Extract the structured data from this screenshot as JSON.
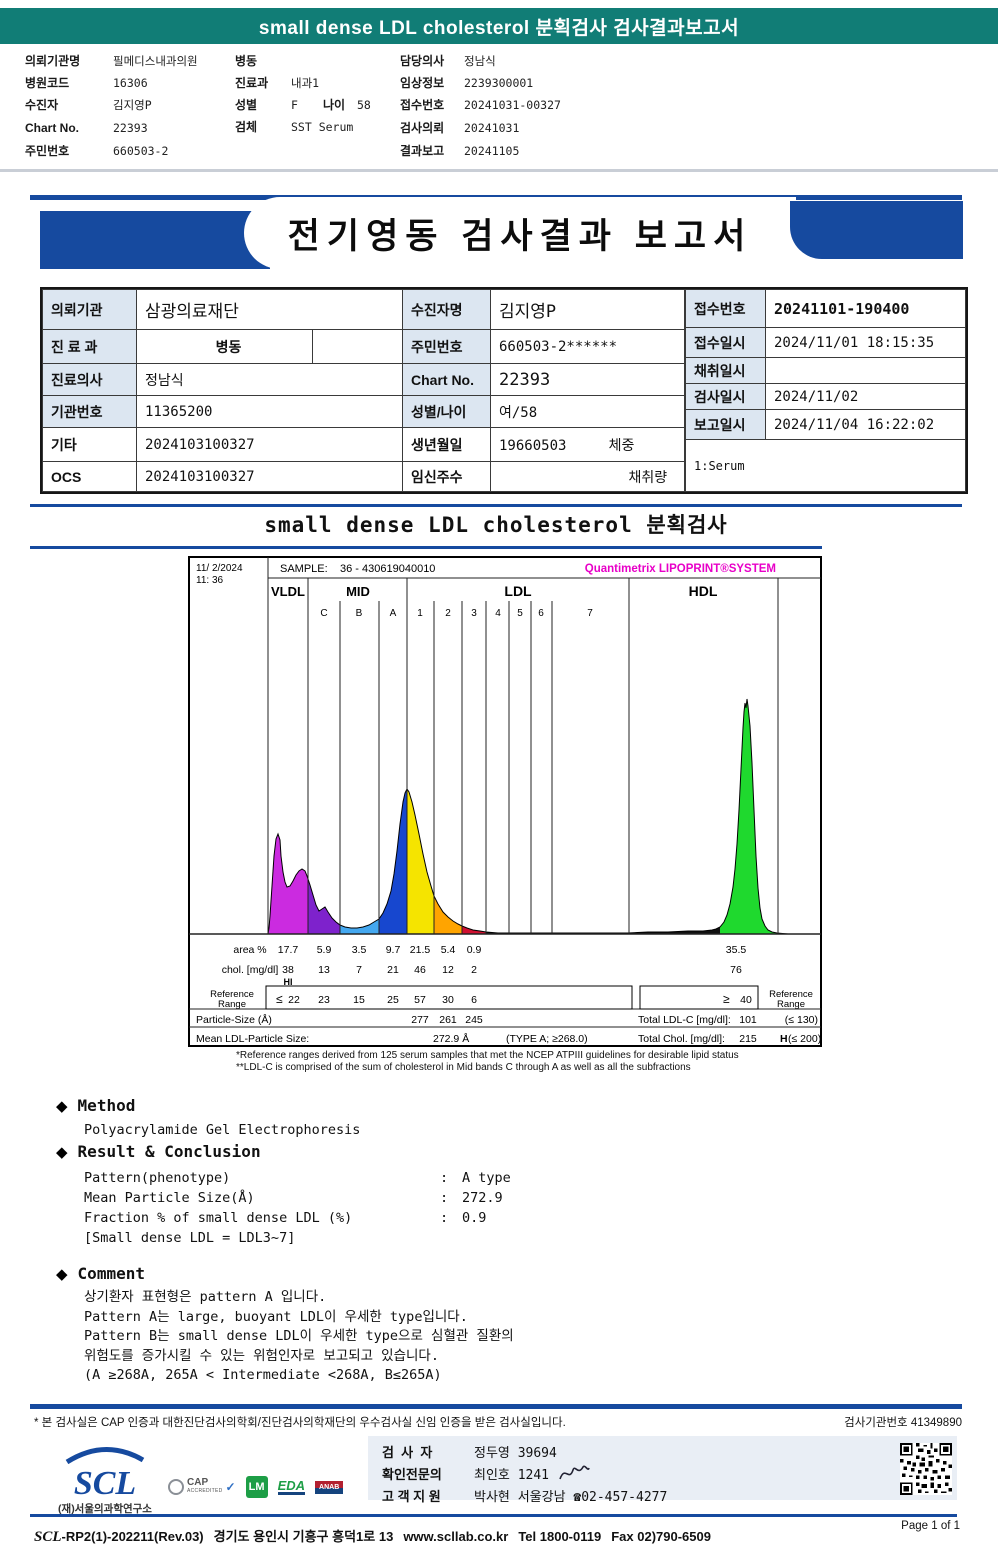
{
  "topbar": {
    "title": "small dense LDL cholesterol 분획검사 검사결과보고서"
  },
  "patient_header": {
    "col1": [
      {
        "label": "의뢰기관명",
        "value": "필메디스내과의원"
      },
      {
        "label": "병원코드",
        "value": "16306"
      },
      {
        "label": "수진자",
        "value": "김지영P"
      },
      {
        "label": "Chart No.",
        "value": "22393"
      },
      {
        "label": "주민번호",
        "value": "660503-2"
      }
    ],
    "col2": {
      "ward_label": "병동",
      "ward_value": "",
      "dept_label": "진료과",
      "dept_value": "내과1",
      "sex_label": "성별",
      "sex_value": "F",
      "age_label": "나이",
      "age_value": "58",
      "specimen_label": "검체",
      "specimen_value": "SST Serum"
    },
    "col3": [
      {
        "label": "담당의사",
        "value": "정남식"
      },
      {
        "label": "임상정보",
        "value": "2239300001"
      },
      {
        "label": "접수번호",
        "value": "20241031-00327"
      },
      {
        "label": "검사의뢰",
        "value": "20241031"
      },
      {
        "label": "결과보고",
        "value": "20241105"
      }
    ]
  },
  "banner": {
    "title": "전기영동 검사결과 보고서"
  },
  "info_table": {
    "r1": {
      "l1": "의뢰기관",
      "v1": "삼광의료재단",
      "l2": "수진자명",
      "v2": "김지영P"
    },
    "r2": {
      "l1": "진 료 과",
      "v1": "병동",
      "v1b": "",
      "l2": "주민번호",
      "v2": "660503-2******"
    },
    "r3": {
      "l1": "진료의사",
      "v1": "정남식",
      "l2": "Chart No.",
      "v2": "22393"
    },
    "r4": {
      "l1": "기관번호",
      "v1": "11365200",
      "l2": "성별/나이",
      "v2": "여/58"
    },
    "r5": {
      "l1": "기타",
      "v1": "2024103100327",
      "l2": "생년월일",
      "v2": "19660503     체중"
    },
    "r6": {
      "l1": "OCS",
      "v1": "2024103100327",
      "l2": "임신주수",
      "v2": "채취량  "
    },
    "right": [
      {
        "label": "접수번호",
        "value": "20241101-190400"
      },
      {
        "label": "접수일시",
        "value": "2024/11/01 18:15:35"
      },
      {
        "label": "채취일시",
        "value": ""
      },
      {
        "label": "검사일시",
        "value": "2024/11/02"
      },
      {
        "label": "보고일시",
        "value": "2024/11/04 16:22:02"
      }
    ],
    "serum_note": "1:Serum"
  },
  "section": {
    "title": "small dense LDL cholesterol 분획검사"
  },
  "chart": {
    "dt1": "11/ 2/2024",
    "dt2": "11: 36",
    "sample_label": "SAMPLE:",
    "sample_value": "36 - 430619040010",
    "system_full": "Quantimetrix LIPOPRINT®SYSTEM",
    "g_vldl": "VLDL",
    "g_mid": "MID",
    "g_ldl": "LDL",
    "g_hdl": "HDL",
    "sub": [
      "C",
      "B",
      "A",
      "1",
      "2",
      "3",
      "4",
      "5",
      "6",
      "7"
    ],
    "area_label": "area %",
    "area": [
      "17.7",
      "5.9",
      "3.5",
      "9.7",
      "21.5",
      "5.4",
      "0.9",
      "35.5"
    ],
    "chol_label": "chol. [mg/dl]",
    "chol": [
      "38",
      "13",
      "7",
      "21",
      "46",
      "12",
      "2",
      "76"
    ],
    "hi": "HI",
    "ref_l1": "Reference",
    "ref_l2": "Range",
    "le": "≤",
    "ge": "≥",
    "ref": [
      "22",
      "23",
      "15",
      "25",
      "57",
      "30",
      "6",
      "40"
    ],
    "particle_label": "Particle-Size (Å)",
    "particle": [
      "277",
      "261",
      "245"
    ],
    "total_ldl_label": "Total LDL-C [mg/dl]:",
    "total_ldl_value": "101",
    "total_ldl_ref": "(≤ 130)",
    "mean_label": "Mean LDL-Particle Size:",
    "mean_value": "272.9 Å",
    "mean_type": "(TYPE A; ≥268.0)",
    "total_chol_label": "Total Chol. [mg/dl]:",
    "total_chol_value": "215",
    "h_flag": "H",
    "total_chol_ref": "(≤ 200)"
  },
  "chart_data": {
    "type": "area",
    "title": "Quantimetrix LIPOPRINT SYSTEM",
    "sample_id": "36 - 430619040010",
    "datetime": "11/ 2/2024 11:36",
    "categories": [
      "VLDL",
      "MID C",
      "MID B",
      "MID A",
      "LDL1",
      "LDL2",
      "LDL3",
      "LDL4",
      "LDL5",
      "LDL6",
      "LDL7",
      "HDL"
    ],
    "series": [
      {
        "name": "area %",
        "values": [
          17.7,
          5.9,
          3.5,
          9.7,
          21.5,
          5.4,
          0.9,
          null,
          null,
          null,
          null,
          35.5
        ]
      },
      {
        "name": "chol. [mg/dl]",
        "values": [
          38,
          13,
          7,
          21,
          46,
          12,
          2,
          null,
          null,
          null,
          null,
          76
        ]
      },
      {
        "name": "reference range",
        "values": [
          "≤22",
          "23",
          "15",
          "25",
          "57",
          "30",
          "6",
          null,
          null,
          null,
          null,
          "≥40"
        ]
      },
      {
        "name": "particle size (Å)",
        "values": [
          null,
          null,
          null,
          null,
          277,
          261,
          245,
          null,
          null,
          null,
          null,
          null
        ]
      }
    ],
    "band_colors": [
      "#cb2be0",
      "#7e22cc",
      "#44a8f0",
      "#1747cf",
      "#f5e400",
      "#ffa400",
      "#d01030",
      "#101010",
      "#101010",
      "#101010",
      "#101010",
      "#1fd92e"
    ],
    "flags": {
      "chol_vldl": "HI"
    },
    "totals": {
      "total_ldl_c_mgdl": 101,
      "total_ldl_c_ref": "≤130",
      "total_chol_mgdl": 215,
      "total_chol_flag": "H",
      "total_chol_ref": "≤200",
      "mean_ldl_particle_size_A": 272.9,
      "phenotype": "TYPE A; ≥268.0"
    },
    "footnotes": [
      "*Reference ranges derived from 125 serum samples that met the NCEP ATPIII guidelines for desirable lipid status",
      "**LDL-C is comprised of the sum of cholesterol in Mid bands C through A as well as all the subfractions"
    ]
  },
  "footnote1": "*Reference ranges derived from 125 serum samples that met the NCEP ATPIII guidelines for desirable lipid status",
  "footnote2": "**LDL-C is comprised of the sum of cholesterol in Mid bands C through A as well as all the subfractions",
  "method": {
    "bullet": "◆",
    "heading": "Method",
    "body": "Polyacrylamide Gel Electrophoresis"
  },
  "result": {
    "bullet": "◆",
    "heading": "Result & Conclusion",
    "rows": [
      {
        "label": "Pattern(phenotype)",
        "colon": ":",
        "value": "A type"
      },
      {
        "label": "Mean Particle Size(Å)",
        "colon": ":",
        "value": "272.9"
      },
      {
        "label": "Fraction % of small dense LDL (%)",
        "colon": ":",
        "value": "0.9"
      }
    ],
    "note": "[Small dense LDL = LDL3~7]"
  },
  "comment": {
    "bullet": "◆",
    "heading": "Comment",
    "lines": [
      "상기환자 표현형은 pattern A 입니다.",
      "Pattern A는 large, buoyant LDL이 우세한 type입니다.",
      "Pattern B는 small dense LDL이 우세한 type으로 심혈관 질환의",
      "위험도를 증가시킬 수 있는 위험인자로 보고되고 있습니다.",
      "(A ≥268A, 265A < Intermediate <268A, B≤265A)"
    ]
  },
  "footer": {
    "cert_note": "* 본 검사실은 CAP 인증과 대한진단검사의학회/진단검사의학재단의 우수검사실 신임 인증을 받은 검사실입니다.",
    "lab_no": "검사기관번호 41349890",
    "scl_logo": "SCL",
    "scl_sub": "(재)서울의과학연구소",
    "cap1": "CAP",
    "cap2": "ACCREDITED",
    "lm": "LM",
    "eda": "EDA",
    "anab": "ANAB",
    "staff": [
      {
        "label": "검  사  자",
        "value": "정두영 39694"
      },
      {
        "label": "확인전문의",
        "value": "최인호 1241"
      },
      {
        "label": "고 객 지 원",
        "value": "박사현 서울강남 ☎02-457-4277"
      }
    ],
    "doc_scl": "SCL",
    "doc_code": "-RP2(1)-202211(Rev.03)",
    "address": "경기도 용인시 기흥구 흥덕1로 13",
    "website": "www.scllab.co.kr",
    "tel": "Tel 1800-0119",
    "fax": "Fax 02)790-6509",
    "page": "Page 1 of 1"
  }
}
